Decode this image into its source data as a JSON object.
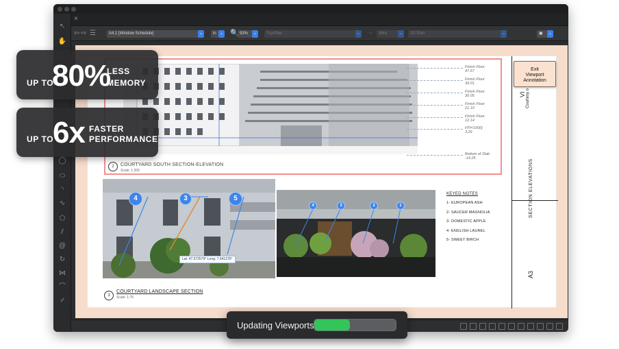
{
  "promos": [
    {
      "prefix": "UP TO",
      "value": "80%",
      "line1": "LESS",
      "line2": "MEMORY"
    },
    {
      "prefix": "UP TO",
      "value": "6x",
      "line1": "FASTER",
      "line2": "PERFORMANCE"
    }
  ],
  "toolbar": {
    "layer_select": "A4.1 [Window Schedule]",
    "unit_select": "in",
    "zoom": "93%",
    "view_select": "Top/Plan",
    "render_select": "Wire",
    "class_select": "2D Plan"
  },
  "sheet": {
    "exit_button": "Exit\nViewport\nAnnotation",
    "title_vertical": "SECTION ELEVATIONS",
    "sheet_number": "A3",
    "courtesy": "Courtesy o",
    "vi": "VI",
    "section_viewport": {
      "number": "2",
      "title": "COURTYARD SOUTH SECTION-ELEVATION",
      "scale": "Scale: 1:200"
    },
    "landscape_viewport": {
      "number": "3",
      "title": "COURTYARD LANDSCAPE SECTION",
      "scale": "Scale: 1:75"
    },
    "floor_labels": [
      {
        "name": "Finish Floor",
        "value": "47.67"
      },
      {
        "name": "Finish Floor",
        "value": "39.01"
      },
      {
        "name": "Finish Floor",
        "value": "30.05"
      },
      {
        "name": "Finish Floor",
        "value": "21.10"
      },
      {
        "name": "Finish Floor",
        "value": "12.14"
      },
      {
        "name": "FFI=100(I)",
        "value": "3.26"
      },
      {
        "name": "Bottom of Slab",
        "value": "-14.25"
      }
    ],
    "keyed_notes": {
      "title": "KEYED NOTES",
      "items": [
        "1- EUROPEAN ASH",
        "2- SAUCER MAGNOLIA",
        "3- DOMESTIC APPLE",
        "4- ENGLISH LAUREL",
        "5- SWEET BIRCH"
      ]
    },
    "markers_left": [
      "4",
      "3",
      "5"
    ],
    "markers_right": [
      "4",
      "3",
      "2",
      "1"
    ],
    "coordinates": "Lat: 47.572579°   Long: 7.541376°"
  },
  "update": {
    "label": "Updating Viewports...",
    "progress": 0.44
  }
}
